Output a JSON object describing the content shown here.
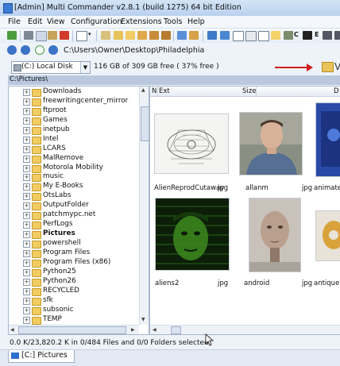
{
  "window": {
    "title": "[Admin] Multi Commander v2.8.1 (build 1275) 64 bit Edition"
  },
  "menu": [
    "File",
    "Edit",
    "View",
    "Configuration",
    "Extensions",
    "Tools",
    "Help"
  ],
  "toolbar": {
    "label_c": "C",
    "label_e": "E"
  },
  "address": {
    "path": "C:\\Users\\Owner\\Desktop\\Philadelphia"
  },
  "drive": {
    "selected": "(C:) Local Disk",
    "free_space": "116 GB of 309 GB free ( 37% free )",
    "right_partial": "V"
  },
  "panel": {
    "path": "C:\\Pictures\\"
  },
  "tree": {
    "items": [
      {
        "label": "Downloads",
        "bold": false
      },
      {
        "label": "freewritingcenter_mirror",
        "bold": false
      },
      {
        "label": "ftproot",
        "bold": false
      },
      {
        "label": "Games",
        "bold": false
      },
      {
        "label": "inetpub",
        "bold": false
      },
      {
        "label": "Intel",
        "bold": false
      },
      {
        "label": "LCARS",
        "bold": false
      },
      {
        "label": "MalRemove",
        "bold": false
      },
      {
        "label": "Motorola Mobility",
        "bold": false
      },
      {
        "label": "music",
        "bold": false
      },
      {
        "label": "My E-Books",
        "bold": false
      },
      {
        "label": "OtsLabs",
        "bold": false
      },
      {
        "label": "OutputFolder",
        "bold": false
      },
      {
        "label": "patchmypc.net",
        "bold": false
      },
      {
        "label": "PerfLogs",
        "bold": false
      },
      {
        "label": "Pictures",
        "bold": true
      },
      {
        "label": "powershell",
        "bold": false
      },
      {
        "label": "Program Files",
        "bold": false
      },
      {
        "label": "Program Files (x86)",
        "bold": false
      },
      {
        "label": "Python25",
        "bold": false
      },
      {
        "label": "Python26",
        "bold": false
      },
      {
        "label": "RECYCLED",
        "bold": false
      },
      {
        "label": "sfk",
        "bold": false
      },
      {
        "label": "subsonic",
        "bold": false
      },
      {
        "label": "TEMP",
        "bold": false
      }
    ]
  },
  "files": {
    "columns": {
      "n": "N",
      "ext": "Ext",
      "size": "Size",
      "d": "D"
    },
    "items": [
      {
        "name": "AlienReprodCutaway",
        "ext": "jpg"
      },
      {
        "name": "allanm",
        "ext": "jpg"
      },
      {
        "name": "animated",
        "ext": ""
      },
      {
        "name": "aliens2",
        "ext": "jpg"
      },
      {
        "name": "android",
        "ext": "jpg"
      },
      {
        "name": "antiquepl",
        "ext": ""
      }
    ]
  },
  "status": {
    "text": "0.0 K/23,820.2 K in 0/484 Files and 0/0 Folders selected"
  },
  "tabs": [
    {
      "label": "[C:] Pictures"
    }
  ],
  "colors": {
    "highlight_arrow": "#d01b1b",
    "folder": "#f0cc63",
    "path_header": "#b9c8dc"
  }
}
